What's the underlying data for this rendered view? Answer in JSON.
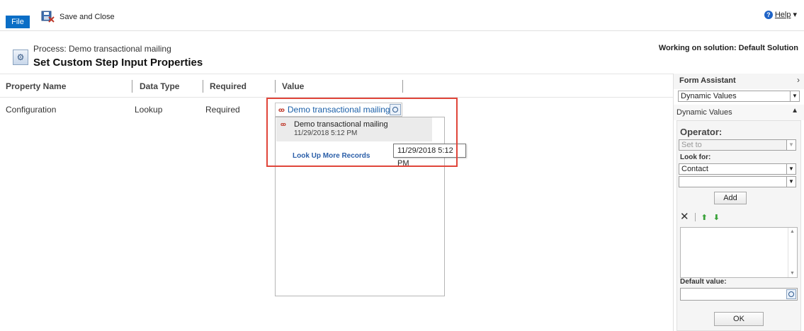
{
  "ribbon": {
    "file_label": "File",
    "save_close_label": "Save and Close",
    "help_label": "Help",
    "help_caret": "▾"
  },
  "header": {
    "process_subtitle": "Process: Demo transactional mailing",
    "title": "Set Custom Step Input Properties",
    "solution_text": "Working on solution: Default Solution"
  },
  "grid": {
    "columns": [
      "Property Name",
      "Data Type",
      "Required",
      "Value"
    ],
    "rows": [
      {
        "property": "Configuration",
        "data_type": "Lookup",
        "required": "Required",
        "value": "Demo transactional mailing"
      }
    ]
  },
  "lookup_dropdown": {
    "item_name": "Demo transactional mailing",
    "item_date": "11/29/2018 5:12 PM",
    "more_records": "Look Up More Records",
    "tooltip": "11/29/2018 5:12 PM"
  },
  "form_assistant": {
    "title": "Form Assistant",
    "expand_arrow": "›",
    "select_value": "Dynamic Values",
    "section_label": "Dynamic Values",
    "collapse_caret": "▲",
    "operator_label": "Operator:",
    "operator_value": "Set to",
    "look_for_label": "Look for:",
    "look_for_value": "Contact",
    "second_select_value": "",
    "add_label": "Add",
    "default_value_label": "Default value:",
    "ok_label": "OK"
  },
  "colors": {
    "file_blue": "#0a6ec6",
    "highlight_red": "#e0453a",
    "link_blue": "#1a5fa8"
  }
}
